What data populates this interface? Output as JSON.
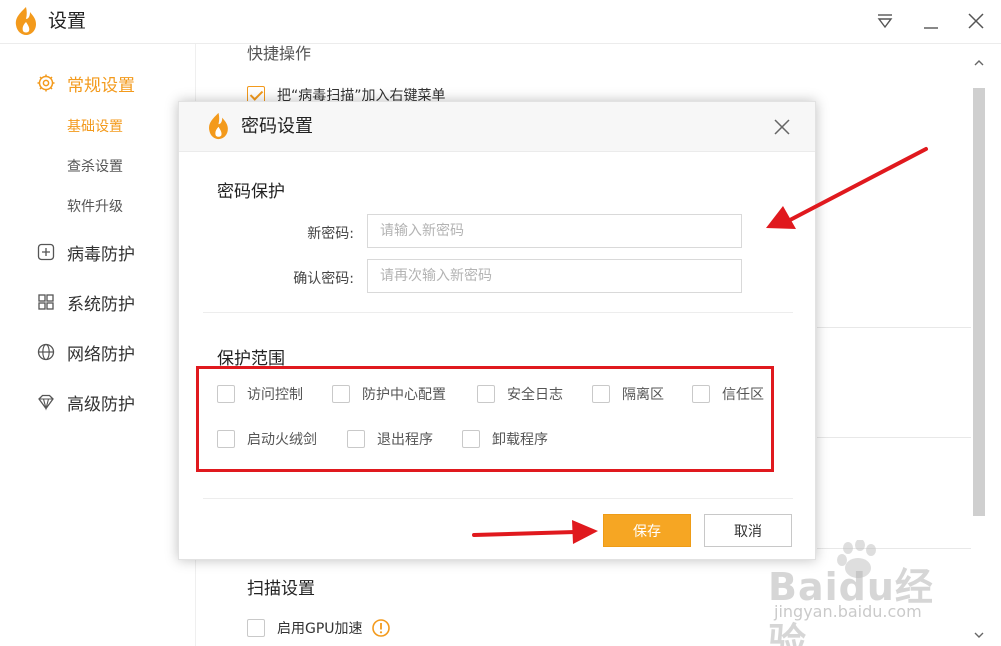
{
  "window": {
    "title": "设置",
    "controls": [
      "menu-icon",
      "minimize-icon",
      "close-icon"
    ]
  },
  "sidebar": {
    "groups": [
      {
        "label": "常规设置",
        "icon": "gear-icon",
        "active": true
      },
      {
        "label": "病毒防护",
        "icon": "plus-square-icon"
      },
      {
        "label": "系统防护",
        "icon": "grid-icon"
      },
      {
        "label": "网络防护",
        "icon": "globe-icon"
      },
      {
        "label": "高级防护",
        "icon": "diamond-icon"
      }
    ],
    "subitems": [
      {
        "label": "基础设置",
        "active": true
      },
      {
        "label": "查杀设置"
      },
      {
        "label": "软件升级"
      }
    ]
  },
  "background": {
    "partial_heading": "快捷操作",
    "context_menu_option": "把“病毒扫描”加入右键菜单",
    "scan_heading": "扫描设置",
    "gpu_option": "启用GPU加速",
    "gpu_info_icon": "info-icon"
  },
  "dialog": {
    "title": "密码设置",
    "section_password": "密码保护",
    "new_password_label": "新密码:",
    "new_password_placeholder": "请输入新密码",
    "confirm_password_label": "确认密码:",
    "confirm_password_placeholder": "请再次输入新密码",
    "section_scope": "保护范围",
    "scope_items": [
      "访问控制",
      "防护中心配置",
      "安全日志",
      "隔离区",
      "信任区",
      "启动火绒剑",
      "退出程序",
      "卸载程序"
    ],
    "save_label": "保存",
    "cancel_label": "取消"
  },
  "annotations": {
    "color": "#e0191e"
  },
  "watermark": {
    "brand": "Baidu经验",
    "url": "jingyan.baidu.com"
  },
  "colors": {
    "accent": "#f39a1c",
    "save_button": "#f6a623"
  }
}
